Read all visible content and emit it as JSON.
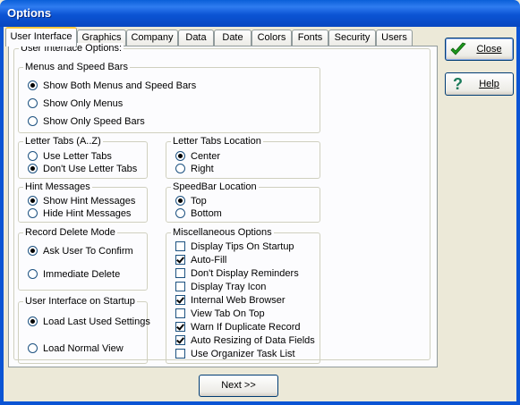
{
  "window": {
    "title": "Options"
  },
  "tabs": [
    "User Interface",
    "Graphics",
    "Company",
    "Data",
    "Date",
    "Colors",
    "Fonts",
    "Security",
    "Users"
  ],
  "panel_title": "User Interface Options:",
  "groups": {
    "menus": {
      "title": "Menus and Speed Bars",
      "options": [
        {
          "label": "Show Both Menus and Speed Bars",
          "selected": true
        },
        {
          "label": "Show Only Menus",
          "selected": false
        },
        {
          "label": "Show Only Speed Bars",
          "selected": false
        }
      ]
    },
    "letter_tabs": {
      "title": "Letter Tabs (A..Z)",
      "options": [
        {
          "label": "Use Letter Tabs",
          "selected": false
        },
        {
          "label": "Don't Use Letter Tabs",
          "selected": true
        }
      ]
    },
    "letter_tabs_location": {
      "title": "Letter Tabs Location",
      "options": [
        {
          "label": "Center",
          "selected": true
        },
        {
          "label": "Right",
          "selected": false
        }
      ]
    },
    "hint_messages": {
      "title": "Hint Messages",
      "options": [
        {
          "label": "Show Hint Messages",
          "selected": true
        },
        {
          "label": "Hide Hint Messages",
          "selected": false
        }
      ]
    },
    "speedbar_location": {
      "title": "SpeedBar Location",
      "options": [
        {
          "label": "Top",
          "selected": true
        },
        {
          "label": "Bottom",
          "selected": false
        }
      ]
    },
    "record_delete": {
      "title": "Record Delete Mode",
      "options": [
        {
          "label": "Ask User To Confirm",
          "selected": true
        },
        {
          "label": "Immediate Delete",
          "selected": false
        }
      ]
    },
    "startup": {
      "title": "User Interface on Startup",
      "options": [
        {
          "label": "Load Last Used Settings",
          "selected": true
        },
        {
          "label": "Load Normal View",
          "selected": false
        }
      ]
    },
    "misc": {
      "title": "Miscellaneous Options",
      "options": [
        {
          "label": "Display Tips On Startup",
          "checked": false
        },
        {
          "label": "Auto-Fill",
          "checked": true
        },
        {
          "label": "Don't Display Reminders",
          "checked": false
        },
        {
          "label": "Display Tray Icon",
          "checked": false
        },
        {
          "label": "Internal Web Browser",
          "checked": true
        },
        {
          "label": "View Tab On Top",
          "checked": false
        },
        {
          "label": "Warn If Duplicate Record",
          "checked": true
        },
        {
          "label": "Auto Resizing of Data Fields",
          "checked": true
        },
        {
          "label": "Use Organizer Task List",
          "checked": false
        }
      ]
    }
  },
  "buttons": {
    "close": {
      "label": "Close",
      "icon": "green-checkmark-icon"
    },
    "help": {
      "label": "Help",
      "icon": "question-mark-icon"
    },
    "next": {
      "label": "Next >>"
    }
  },
  "colors": {
    "title_bar": "#0b54d4",
    "dialog_bg": "#ece9d8",
    "panel_bg": "#fcfcfe",
    "active_tab_accent": "#ffc83c"
  }
}
